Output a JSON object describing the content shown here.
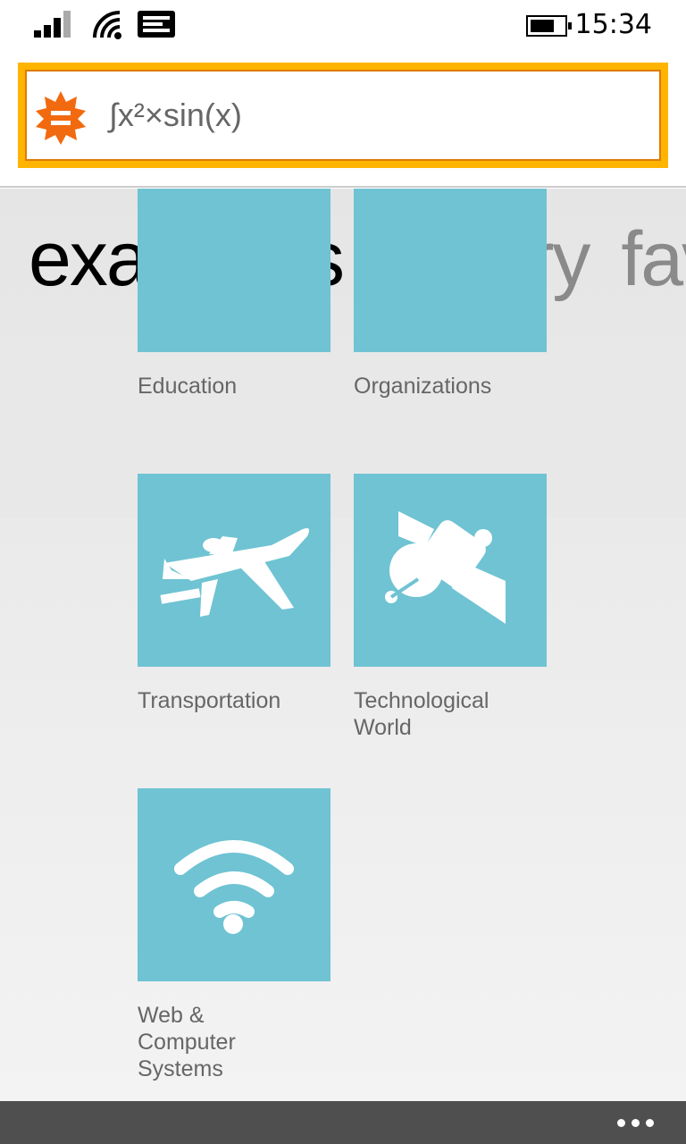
{
  "status_bar": {
    "time": "15:34",
    "icons": [
      "signal-icon",
      "wifi-icon",
      "message-icon",
      "battery-icon"
    ]
  },
  "search": {
    "value": "∫x²×sin(x)",
    "logo": "wolfram-alpha-icon",
    "accent": "#ffb400"
  },
  "pivot": {
    "tabs": [
      {
        "label": "examples",
        "active": true
      },
      {
        "label": "history"
      },
      {
        "label": "favorites"
      }
    ]
  },
  "tiles": [
    {
      "label": "Education",
      "icon": "education-icon"
    },
    {
      "label": "Organizations",
      "icon": "organizations-icon"
    },
    {
      "label": "Transportation",
      "icon": "airplane-icon"
    },
    {
      "label": "Technological World",
      "label_lines": [
        "Technological",
        "World"
      ],
      "icon": "satellite-icon"
    },
    {
      "label": "Web & Computer Systems",
      "label_lines": [
        "Web &",
        "Computer",
        "Systems"
      ],
      "icon": "wifi-icon"
    }
  ],
  "tile_color": "#6fc3d3",
  "appbar": {
    "more": "more-icon"
  }
}
